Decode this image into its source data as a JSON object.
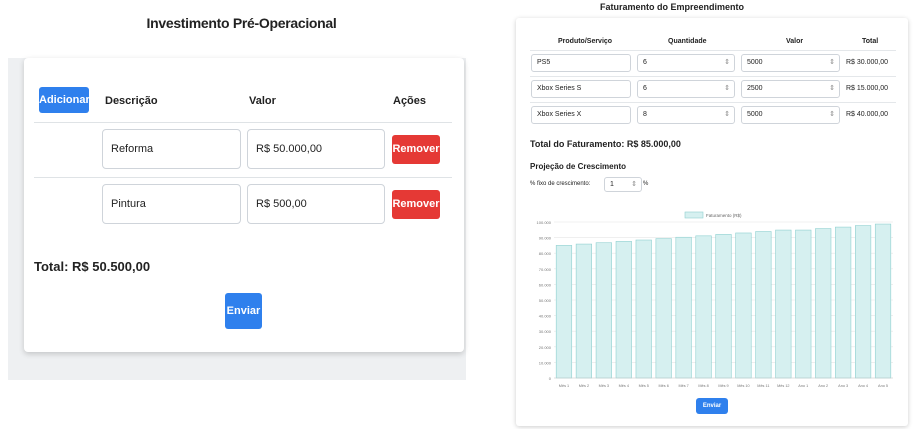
{
  "left": {
    "title": "Investimento Pré-Operacional",
    "add_label": "Adicionar",
    "headers": {
      "description": "Descrição",
      "value": "Valor",
      "actions": "Ações"
    },
    "rows": [
      {
        "description": "Reforma",
        "value": "R$ 50.000,00",
        "remove_label": "Remover"
      },
      {
        "description": "Pintura",
        "value": "R$ 500,00",
        "remove_label": "Remover"
      }
    ],
    "total": "Total: R$ 50.500,00",
    "submit_label": "Enviar"
  },
  "right": {
    "title": "Faturamento do Empreendimento",
    "headers": {
      "product": "Produto/Serviço",
      "quantity": "Quantidade",
      "value": "Valor",
      "total": "Total"
    },
    "rows": [
      {
        "product": "PS5",
        "quantity": "6",
        "value": "5000",
        "total": "R$ 30.000,00"
      },
      {
        "product": "Xbox Series S",
        "quantity": "6",
        "value": "2500",
        "total": "R$ 15.000,00"
      },
      {
        "product": "Xbox Series X",
        "quantity": "8",
        "value": "5000",
        "total": "R$ 40.000,00"
      }
    ],
    "revenue_total": "Total do Faturamento: R$ 85.000,00",
    "growth_title": "Projeção de Crescimento",
    "growth_label": "% fixo de crescimento:",
    "growth_value": "1",
    "growth_unit": "%",
    "submit_label": "Enviar"
  },
  "colors": {
    "primary": "#2f80ed",
    "danger": "#e53935",
    "bar_fill": "#d6f0f0",
    "bar_stroke": "#8fd0d0"
  },
  "chart_data": {
    "type": "bar",
    "legend": "Faturamento (R$)",
    "legend_position": "top-center",
    "grid": true,
    "ylim": [
      0,
      100000
    ],
    "yticks": [
      "0",
      "10.000",
      "20.000",
      "30.000",
      "40.000",
      "50.000",
      "60.000",
      "70.000",
      "80.000",
      "90.000",
      "100.000"
    ],
    "categories": [
      "Mês 1",
      "Mês 2",
      "Mês 3",
      "Mês 4",
      "Mês 5",
      "Mês 6",
      "Mês 7",
      "Mês 8",
      "Mês 9",
      "Mês 10",
      "Mês 11",
      "Mês 12",
      "Ano 1",
      "Ano 2",
      "Ano 3",
      "Ano 4",
      "Ano 5"
    ],
    "values": [
      85000,
      85850,
      86709,
      87576,
      88451,
      89336,
      90229,
      91132,
      92043,
      92963,
      93893,
      94832,
      94832,
      95780,
      96738,
      97705,
      98682
    ]
  }
}
